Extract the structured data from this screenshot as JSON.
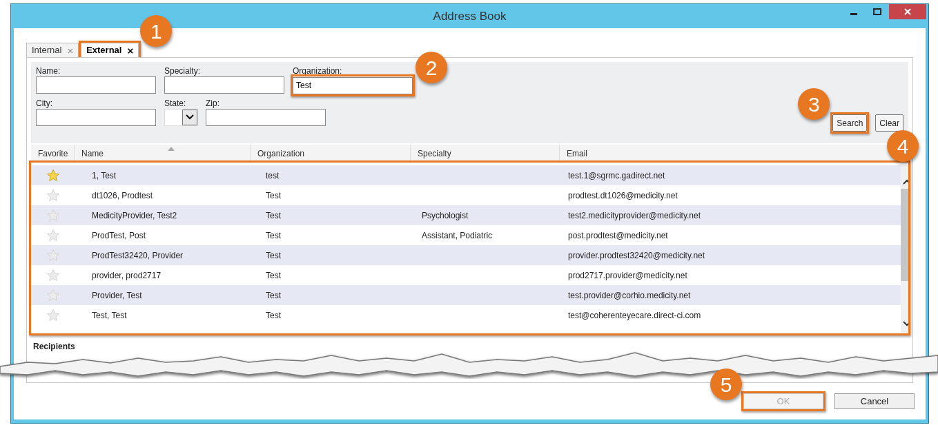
{
  "window": {
    "title": "Address Book"
  },
  "tabs": [
    {
      "label": "Internal",
      "selected": false,
      "close": "×"
    },
    {
      "label": "External",
      "selected": true,
      "close": "×"
    }
  ],
  "search_form": {
    "fields": [
      {
        "label": "Name:"
      },
      {
        "label": "Specialty:"
      },
      {
        "label": "Organization:",
        "value": "Test"
      },
      {
        "label": "City:"
      },
      {
        "label": "Zip:"
      }
    ],
    "state_label": "State:",
    "buttons": [
      {
        "label": "Search"
      },
      {
        "label": "Clear"
      }
    ]
  },
  "table": {
    "columns": [
      "Favorite",
      "Name",
      "Organization",
      "Specialty",
      "Email"
    ],
    "rows": [
      {
        "favorite": true,
        "name": "1, Test",
        "organization": "test",
        "email": "test.1@sgrmc.gadirect.net"
      },
      {
        "favorite": false,
        "name": "dt1026, Prodtest",
        "organization": "Test",
        "email": "prodtest.dt1026@medicity.net"
      },
      {
        "favorite": false,
        "name": "MedicityProvider, Test2",
        "organization": "Test",
        "specialty": "Psychologist",
        "email": "test2.medicityprovider@medicity.net"
      },
      {
        "favorite": false,
        "name": "ProdTest, Post",
        "organization": "Test",
        "specialty": "Assistant, Podiatric",
        "email": "post.prodtest@medicity.net"
      },
      {
        "favorite": false,
        "name": "ProdTest32420, Provider",
        "organization": "Test",
        "email": "provider.prodtest32420@medicity.net"
      },
      {
        "favorite": false,
        "name": "provider, prod2717",
        "organization": "Test",
        "email": "prod2717.provider@medicity.net"
      },
      {
        "favorite": false,
        "name": "Provider, Test",
        "organization": "Test",
        "email": "test.provider@corhio.medicity.net"
      },
      {
        "favorite": false,
        "name": "Test, Test",
        "organization": "Test",
        "email": "test@coherenteyecare.direct-ci.com"
      }
    ]
  },
  "recipients_label": "Recipients",
  "buttons": [
    {
      "label": "OK",
      "disabled": true
    },
    {
      "label": "Cancel",
      "disabled": false
    }
  ],
  "annotations": [
    {
      "label": "1"
    },
    {
      "label": "2"
    },
    {
      "label": "3"
    },
    {
      "label": "4"
    },
    {
      "label": "5"
    }
  ]
}
